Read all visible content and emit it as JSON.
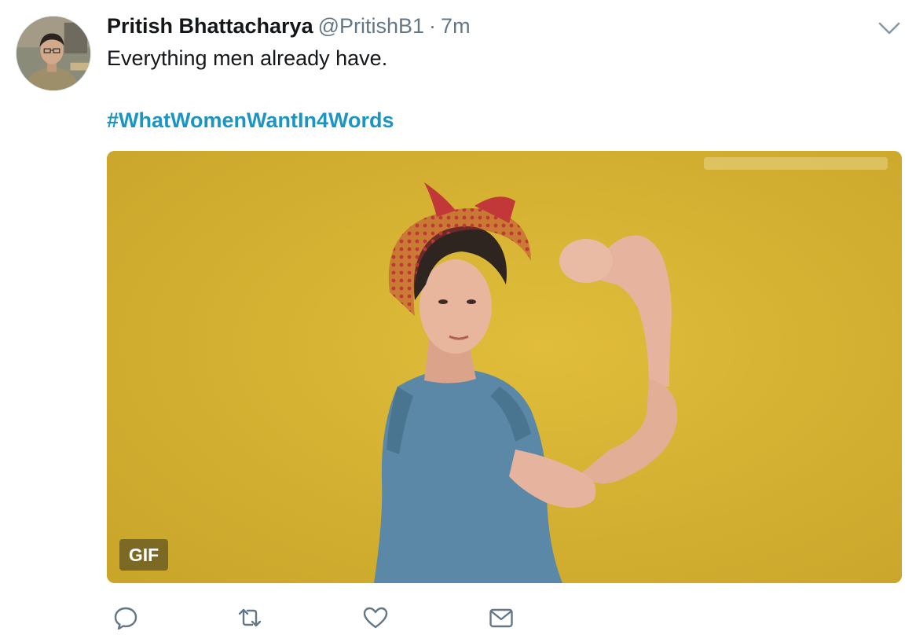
{
  "tweet": {
    "author_name": "Pritish Bhattacharya",
    "author_handle": "@PritishB1",
    "separator": "·",
    "time": "7m",
    "text": "Everything men already have.",
    "hashtag": "#WhatWomenWantIn4Words"
  },
  "media": {
    "badge": "GIF"
  },
  "icons": {
    "caret": "chevron-down-icon",
    "reply": "reply-icon",
    "retweet": "retweet-icon",
    "like": "heart-icon",
    "message": "envelope-icon"
  },
  "colors": {
    "hashtag": "#1b95c3",
    "muted": "#657786",
    "media_background": "#d9b42d"
  }
}
